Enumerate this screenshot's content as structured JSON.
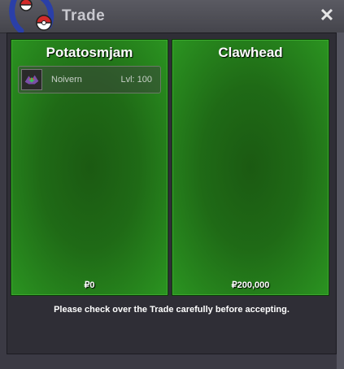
{
  "window": {
    "title": "Trade",
    "close_glyph": "✕"
  },
  "trade": {
    "left": {
      "player_name": "Potatosmjam",
      "money": "₽0",
      "pokemon": [
        {
          "name": "Noivern",
          "level": "Lvl: 100",
          "icon": "noivern-icon"
        }
      ]
    },
    "right": {
      "player_name": "Clawhead",
      "money": "₽200,000",
      "pokemon": []
    },
    "notice": "Please check over the Trade carefully before accepting."
  },
  "colors": {
    "panel_green": "#1f6a16",
    "panel_edge": "#2b9421",
    "window_bg": "#3b3a44",
    "title_text": "#c9c9cf"
  }
}
